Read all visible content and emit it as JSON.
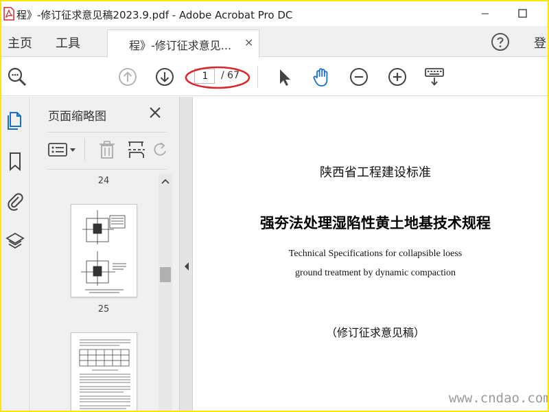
{
  "window": {
    "title": "程》-修订征求意见稿2023.9.pdf - Adobe Acrobat Pro DC"
  },
  "tabs": {
    "home": "主页",
    "tools": "工具",
    "document": "程》-修订征求意见...",
    "close": "×",
    "login": "登"
  },
  "toolbar": {
    "current_page": "1",
    "total_pages": "/ 67"
  },
  "thumbnails": {
    "title": "页面缩略图",
    "pages": [
      "24",
      "25"
    ]
  },
  "document": {
    "org": "陕西省工程建设标准",
    "title": "强夯法处理湿陷性黄土地基技术规程",
    "english_line1": "Technical Specifications for collapsible loess",
    "english_line2": "ground treatment by dynamic compaction",
    "status": "（修订征求意见稿）"
  },
  "watermark": "www.cndao.com",
  "colors": {
    "accent": "#1a6ec9",
    "annotation": "#d9262b",
    "frame": "#ffe600",
    "pdf_red": "#d9262b"
  },
  "icons": {
    "search": "search-zoom-icon",
    "prev": "arrow-up-icon",
    "next": "arrow-down-icon",
    "select": "cursor-icon",
    "hand": "hand-icon",
    "zoom_out": "minus-circle-icon",
    "zoom_in": "plus-circle-icon",
    "keyboard": "keyboard-icon",
    "help": "help-icon",
    "pages": "pages-icon",
    "bookmark": "bookmark-icon",
    "attachment": "paperclip-icon",
    "layers": "layers-icon"
  }
}
